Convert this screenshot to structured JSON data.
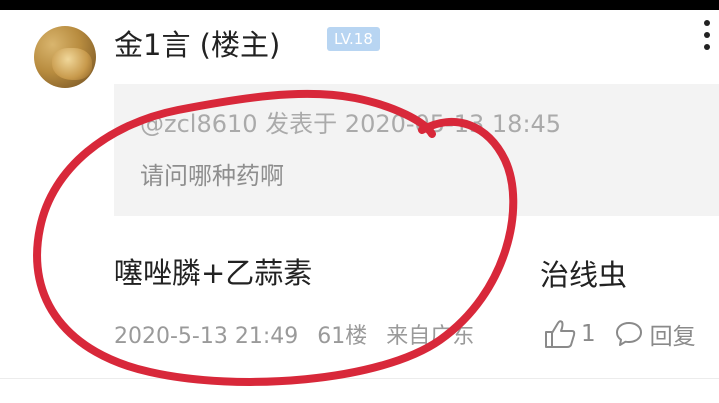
{
  "post": {
    "username": "金1言",
    "op_label": "(楼主)",
    "level": "LV.18",
    "quote": {
      "meta": "@zcl8610 发表于 2020-05-13 18:45",
      "text": "请问哪种药啊"
    },
    "reply_text": "噻唑膦+乙蒜素",
    "timestamp": "2020-5-13 21:49",
    "floor": "61楼",
    "location": "来自广东",
    "like_count": "1",
    "reply_label": "回复"
  },
  "annotation": {
    "handwritten_note": "治线虫",
    "circle_color": "#d8283a"
  },
  "colors": {
    "level_badge": "#b8d5f2",
    "quote_bg": "#f3f3f3",
    "meta_text": "#9a9a9a"
  }
}
